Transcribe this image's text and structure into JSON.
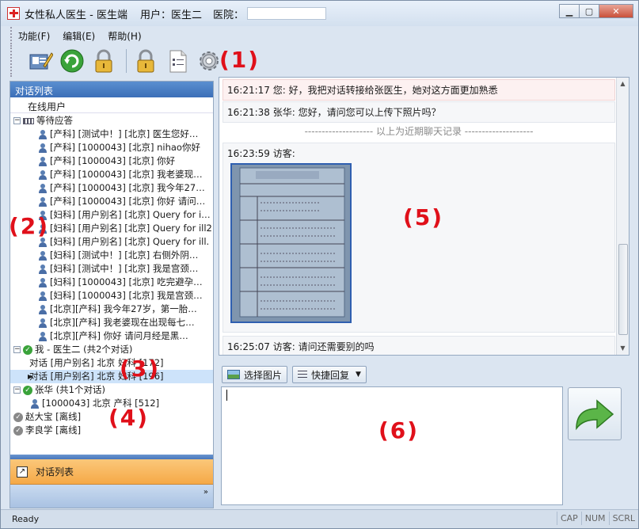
{
  "window": {
    "title": "女性私人医生 - 医生端",
    "user_label": "用户：医生二",
    "hospital_label": "医院：",
    "hospital_value": ""
  },
  "menu": {
    "items": [
      {
        "label": "功能(F)"
      },
      {
        "label": "编辑(E)"
      },
      {
        "label": "帮助(H)"
      }
    ]
  },
  "toolbar": {
    "icons": [
      "edit-profile-icon",
      "refresh-icon",
      "lock-icon",
      "lock-icon",
      "document-icon",
      "gear-icon"
    ]
  },
  "annotations": {
    "a1": "(1)",
    "a2": "(2)",
    "a3": "(3)",
    "a4": "(4)",
    "a5": "(5)",
    "a6": "(6)"
  },
  "left_panel": {
    "title": "对话列表",
    "column_header": "在线用户",
    "tree": [
      {
        "level": 0,
        "kind": "group-queue",
        "label": "等待应答",
        "expander": "−"
      },
      {
        "level": 2,
        "kind": "user",
        "label": "[产科] [测试中！] [北京] 医生您好…"
      },
      {
        "level": 2,
        "kind": "user",
        "label": "[产科] [1000043] [北京] nihao你好"
      },
      {
        "level": 2,
        "kind": "user",
        "label": "[产科] [1000043] [北京] 你好"
      },
      {
        "level": 2,
        "kind": "user",
        "label": "[产科] [1000043] [北京] 我老婆现…"
      },
      {
        "level": 2,
        "kind": "user",
        "label": "[产科] [1000043] [北京] 我今年27…"
      },
      {
        "level": 2,
        "kind": "user",
        "label": "[产科] [1000043] [北京] 你好  请问…"
      },
      {
        "level": 2,
        "kind": "user",
        "label": "[妇科] [用户别名] [北京] Query for i…"
      },
      {
        "level": 2,
        "kind": "user",
        "label": "[妇科] [用户别名] [北京] Query for ill2"
      },
      {
        "level": 2,
        "kind": "user",
        "label": "[妇科] [用户别名] [北京] Query for ill."
      },
      {
        "level": 2,
        "kind": "user",
        "label": "[妇科] [测试中！] [北京] 右侧外阴…"
      },
      {
        "level": 2,
        "kind": "user",
        "label": "[妇科] [测试中！] [北京] 我是宫颈…"
      },
      {
        "level": 2,
        "kind": "user",
        "label": "[妇科] [1000043] [北京] 吃完避孕…"
      },
      {
        "level": 2,
        "kind": "user",
        "label": "[妇科] [1000043] [北京] 我是宫颈…"
      },
      {
        "level": 2,
        "kind": "user",
        "label": "[北京][产科] 我今年27岁，第一胎…"
      },
      {
        "level": 2,
        "kind": "user",
        "label": "[北京][产科] 我老婆现在出现每七…"
      },
      {
        "level": 2,
        "kind": "user",
        "label": "[北京][产科] 你好  请问月经是黑…"
      },
      {
        "level": 0,
        "kind": "group-online",
        "label": "我 - 医生二 (共2个对话)",
        "expander": "−"
      },
      {
        "level": 1,
        "kind": "conv",
        "label": "对话 [用户别名] 北京 妇科 [172]"
      },
      {
        "level": 1,
        "kind": "conv",
        "label": "对话 [用户别名] 北京 妇科 [196]",
        "selected": true
      },
      {
        "level": 0,
        "kind": "group-online",
        "label": "张华 (共1个对话)",
        "expander": "−"
      },
      {
        "level": 1,
        "kind": "user",
        "label": "[1000043] 北京 产科 [512]"
      },
      {
        "level": 0,
        "kind": "offline",
        "label": "赵大宝 [离线]"
      },
      {
        "level": 0,
        "kind": "offline",
        "label": "李良学 [离线]"
      }
    ],
    "bottom_tab": "对话列表",
    "footer_chevron": "»"
  },
  "chat": {
    "messages": [
      {
        "time": "16:21:17",
        "sender": "您",
        "text": "好，我把对话转接给张医生，她对这方面更加熟悉"
      },
      {
        "time": "16:21:38",
        "sender": "张华",
        "text": "您好，请问您可以上传下照片吗？"
      },
      {
        "time": "16:23:59",
        "sender": "访客",
        "text": ""
      },
      {
        "time": "16:25:07",
        "sender": "访客",
        "text": "请问还需要别的吗"
      }
    ],
    "history_divider": "--------------------  以上为近期聊天记录  --------------------"
  },
  "input": {
    "select_image_label": "选择图片",
    "quick_reply_label": "快捷回复",
    "value": ""
  },
  "statusbar": {
    "text": "Ready",
    "indicators": [
      "CAP",
      "NUM",
      "SCRL"
    ]
  }
}
